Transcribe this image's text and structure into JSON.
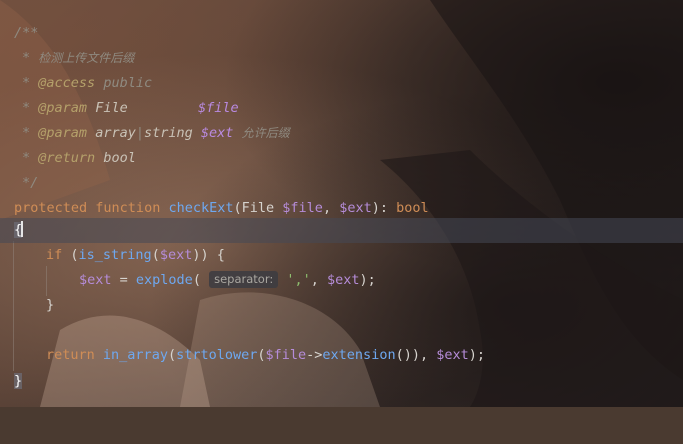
{
  "code": {
    "doc_open": "/**",
    "doc_star": "*",
    "doc_summary": "检测上传文件后缀",
    "tag_access": "@access",
    "access_value": "public",
    "tag_param": "@param",
    "param1_type": "File",
    "param1_var": "$file",
    "param2_type_a": "array",
    "param2_type_sep": "|",
    "param2_type_b": "string",
    "param2_var": "$ext",
    "param2_desc": "允许后缀",
    "tag_return": "@return",
    "return_type": "bool",
    "doc_close": "*/",
    "kw_protected": "protected",
    "kw_function": "function",
    "method_name": "checkExt",
    "sig_open": "(",
    "sig_type": "File",
    "sig_var1": "$file",
    "sig_comma": ", ",
    "sig_var2": "$ext",
    "sig_close": "): ",
    "sig_return": "bool",
    "brace_open": "{",
    "kw_if": "if",
    "if_open": " (",
    "fn_is_string": "is_string",
    "paren_open": "(",
    "if_var": "$ext",
    "if_close": ")) {",
    "assign_var": "$ext",
    "assign_eq": " = ",
    "fn_explode": "explode",
    "explode_open": "(",
    "param_hint": "separator:",
    "explode_str": "','",
    "explode_comma": ", ",
    "explode_var": "$ext",
    "explode_close": ");",
    "brace_close_inner": "}",
    "kw_return": "return",
    "fn_in_array": "in_array",
    "fn_strtolower": "strtolower",
    "ret_var1": "$file",
    "ret_arrow": "->",
    "fn_extension": "extension",
    "ret_mid": "()), ",
    "ret_var2": "$ext",
    "ret_close": ");",
    "brace_close": "}"
  }
}
